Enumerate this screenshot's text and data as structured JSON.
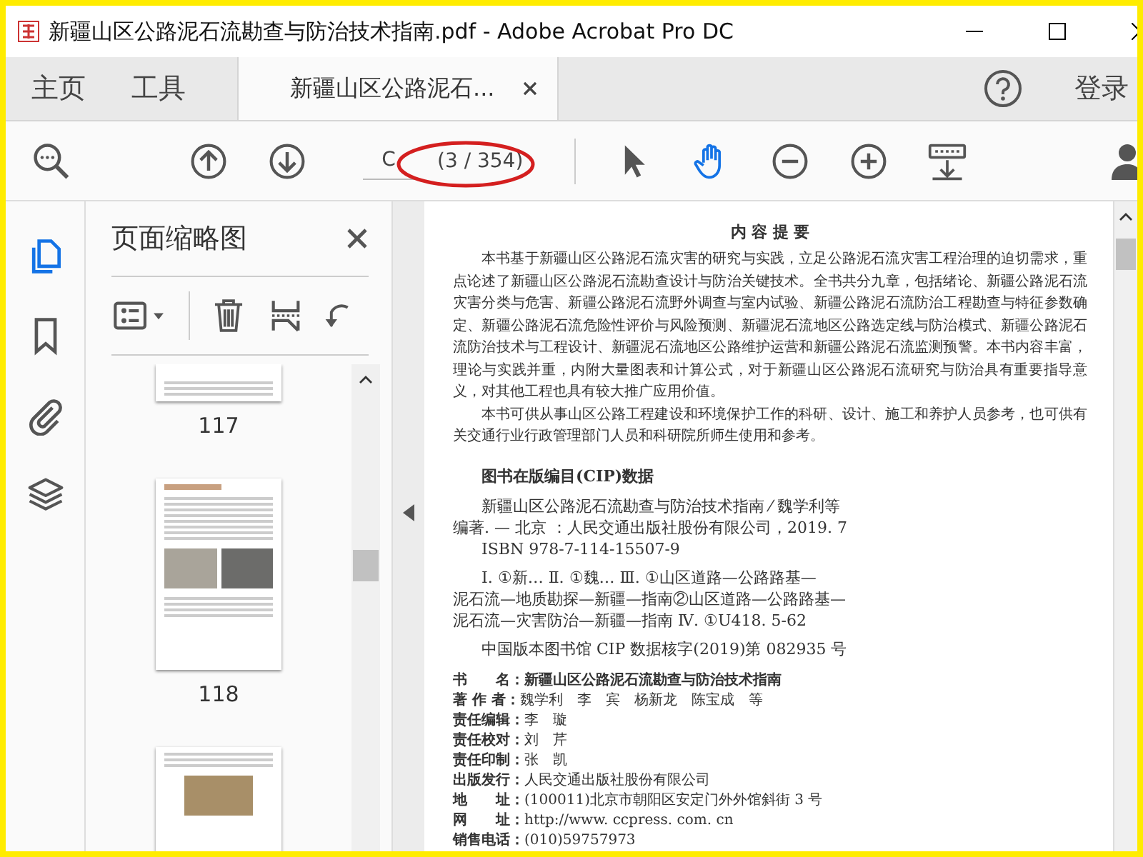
{
  "window": {
    "title": "新疆山区公路泥石流勘查与防治技术指南.pdf - Adobe Acrobat Pro DC"
  },
  "nav_tabs": [
    {
      "label": "主页",
      "selected": false,
      "closable": false
    },
    {
      "label": "工具",
      "selected": false,
      "closable": false
    },
    {
      "label": "新疆山区公路泥石...",
      "selected": true,
      "closable": true
    }
  ],
  "account": {
    "sign_in": "登录"
  },
  "toolbar": {
    "page_field": {
      "value": "C"
    },
    "page_count": "(3 / 354)",
    "tools": [
      {
        "kind": "select",
        "selected": false
      },
      {
        "kind": "hand",
        "selected": true
      }
    ]
  },
  "rail": [
    {
      "kind": "pages",
      "selected": true
    },
    {
      "kind": "bookmarks",
      "selected": false
    },
    {
      "kind": "attachments",
      "selected": false
    },
    {
      "kind": "layers",
      "selected": false
    }
  ],
  "thumbnail_panel": {
    "title": "页面缩略图",
    "thumbnails": [
      {
        "label": "117",
        "kind": "cut-top"
      },
      {
        "label": "118",
        "kind": "full"
      }
    ]
  },
  "document": {
    "heading": "内 容 提 要",
    "paragraphs": [
      "本书基于新疆山区公路泥石流灾害的研究与实践，立足公路泥石流灾害工程治理的迫切需求，重点论述了新疆山区公路泥石流勘查设计与防治关键技术。全书共分九章，包括绪论、新疆公路泥石流灾害分类与危害、新疆公路泥石流野外调查与室内试验、新疆公路泥石流防治工程勘查与特征参数确定、新疆公路泥石流危险性评价与风险预测、新疆泥石流地区公路选定线与防治模式、新疆公路泥石流防治技术与工程设计、新疆泥石流地区公路维护运营和新疆公路泥石流监测预警。本书内容丰富，理论与实践并重，内附大量图表和计算公式，对于新疆山区公路泥石流研究与防治具有重要指导意义，对其他工程也具有较大推广应用价值。",
      "本书可供从事山区公路工程建设和环境保护工作的科研、设计、施工和养护人员参考，也可供有关交通行业行政管理部门人员和科研院所师生使用和参考。"
    ],
    "cip_heading": "图书在版编目(CIP)数据",
    "cip_blocks": [
      [
        "新疆山区公路泥石流勘查与防治技术指南 ⁄ 魏学利等",
        "编著. — 北京 ：人民交通出版社股份有限公司，2019. 7",
        "ISBN  978-7-114-15507-9"
      ],
      [
        "Ⅰ. ①新…   Ⅱ. ①魏…   Ⅲ. ①山区道路—公路路基—",
        "泥石流—地质勘探—新疆—指南②山区道路—公路路基—",
        "泥石流—灾害防治—新疆—指南   Ⅳ. ①U418. 5-62"
      ],
      [
        "中国版本图书馆 CIP 数据核字(2019)第 082935 号"
      ]
    ],
    "info": [
      {
        "label": "书　　名：",
        "value": "新疆山区公路泥石流勘查与防治技术指南",
        "bold_value": true
      },
      {
        "label": "著 作 者：",
        "value": "魏学利　李　宾　杨新龙　陈宝成　等",
        "bold_value": false
      },
      {
        "label": "责任编辑：",
        "value": "李　璇",
        "bold_value": false
      },
      {
        "label": "责任校对：",
        "value": "刘　芹",
        "bold_value": false
      },
      {
        "label": "责任印制：",
        "value": "张　凯",
        "bold_value": false
      },
      {
        "label": "出版发行：",
        "value": "人民交通出版社股份有限公司",
        "bold_value": false
      },
      {
        "label": "地　　址：",
        "value": "(100011)北京市朝阳区安定门外外馆斜街 3 号",
        "bold_value": false
      },
      {
        "label": "网　　址：",
        "value": "http://www. ccpress. com. cn",
        "bold_value": false
      },
      {
        "label": "销售电话：",
        "value": "(010)59757973",
        "bold_value": false
      }
    ]
  }
}
